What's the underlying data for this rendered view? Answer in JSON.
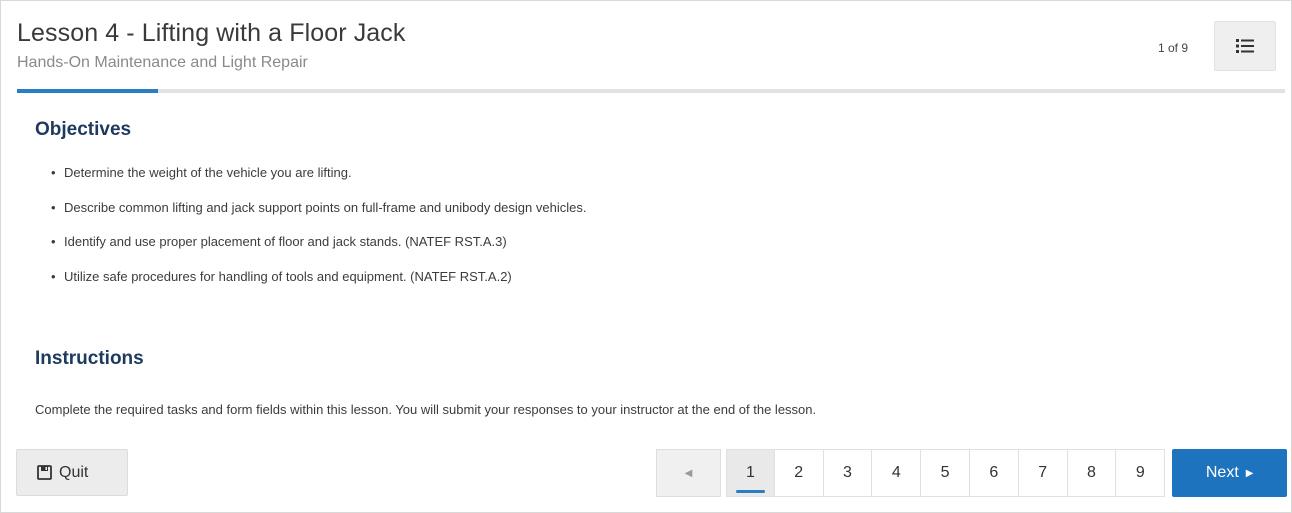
{
  "header": {
    "title": "Lesson 4 - Lifting with a Floor Jack",
    "subtitle": "Hands-On Maintenance and Light Repair",
    "page_count": "1 of 9",
    "menu_icon": "list-icon"
  },
  "progress": {
    "fraction": 0.111,
    "color": "#2a7fc4"
  },
  "objectives": {
    "heading": "Objectives",
    "items": [
      "Determine the weight of the vehicle you are lifting.",
      "Describe common lifting and jack support points on full-frame and unibody design vehicles.",
      "Identify and use proper placement of floor and jack stands. (NATEF RST.A.3)",
      "Utilize safe procedures for handling of tools and equipment. (NATEF RST.A.2)"
    ]
  },
  "instructions": {
    "heading": "Instructions",
    "text": "Complete the required tasks and form fields within this lesson. You will submit your responses to your instructor at the end of the lesson."
  },
  "footer": {
    "quit_label": "Quit",
    "quit_icon": "save-icon",
    "prev_icon": "◀",
    "pages": [
      "1",
      "2",
      "3",
      "4",
      "5",
      "6",
      "7",
      "8",
      "9"
    ],
    "current_page": "1",
    "next_label": "Next",
    "next_icon": "▶"
  },
  "colors": {
    "accent": "#1e73be",
    "heading": "#1e3a5f"
  }
}
